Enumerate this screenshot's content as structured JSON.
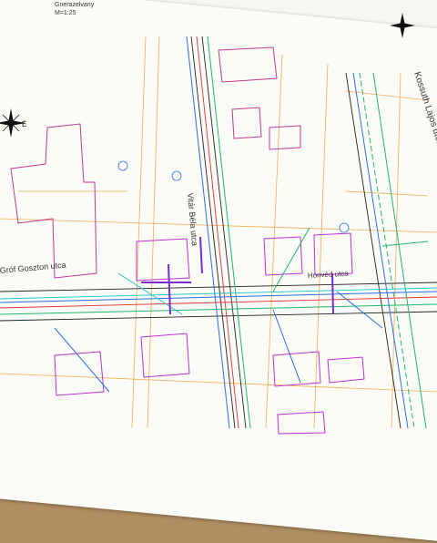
{
  "header": {
    "title_line1": "Gnerazelvany",
    "scale": "M=1:25"
  },
  "streets": {
    "kossuth": "Kossuth Lajos utca",
    "vinar": "Vitár Béla utca",
    "goszton": "Gróf Goszton utca",
    "honvéd": "Honvéd utca"
  },
  "colors": {
    "paper": "#fbfbf8",
    "table": "#b08e62",
    "orange_line": "#f2a343",
    "magenta": "#c12fd6",
    "blue": "#2b6fe0",
    "green": "#1fb86c",
    "red": "#e03030",
    "dark": "#222222"
  },
  "icons": {
    "north_arrow_left": "compass-rose-icon",
    "north_arrow_right": "compass-rose-icon"
  }
}
